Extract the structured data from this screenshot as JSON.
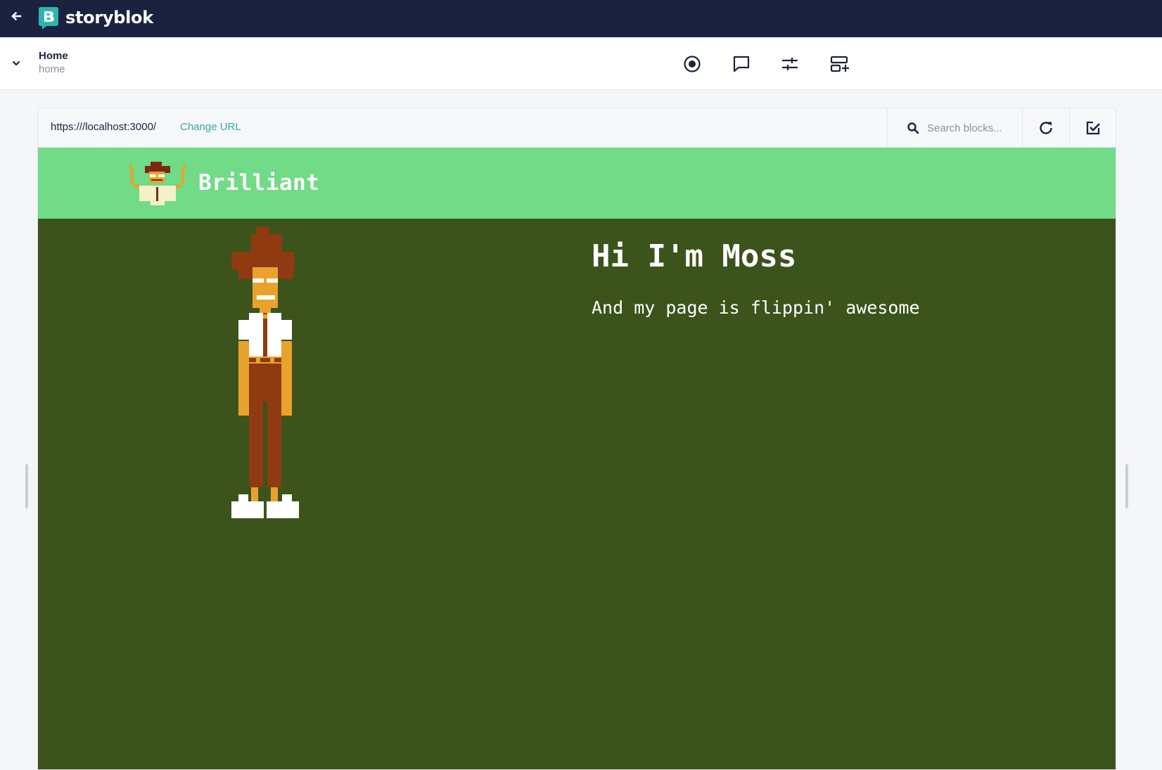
{
  "app": {
    "brand": "storyblok",
    "back_icon": "arrow-left-icon",
    "logo_icon": "storyblok-logo-icon"
  },
  "story": {
    "title": "Home",
    "slug": "home"
  },
  "toolbar": {
    "icons": [
      "record-icon",
      "comment-icon",
      "settings-sliders-icon",
      "add-block-icon"
    ]
  },
  "preview": {
    "url": "https:///localhost:3000/",
    "change_url_label": "Change URL",
    "search_placeholder": "Search blocks...",
    "search_value": ""
  },
  "site": {
    "name": "Brilliant",
    "hero_title": "Hi I'm Moss",
    "hero_subtitle": "And my page is flippin' awesome",
    "header_color": "#71db87",
    "main_color": "#3c531c"
  },
  "colors": {
    "topbar": "#1b2240",
    "accent": "#35a8a4"
  }
}
